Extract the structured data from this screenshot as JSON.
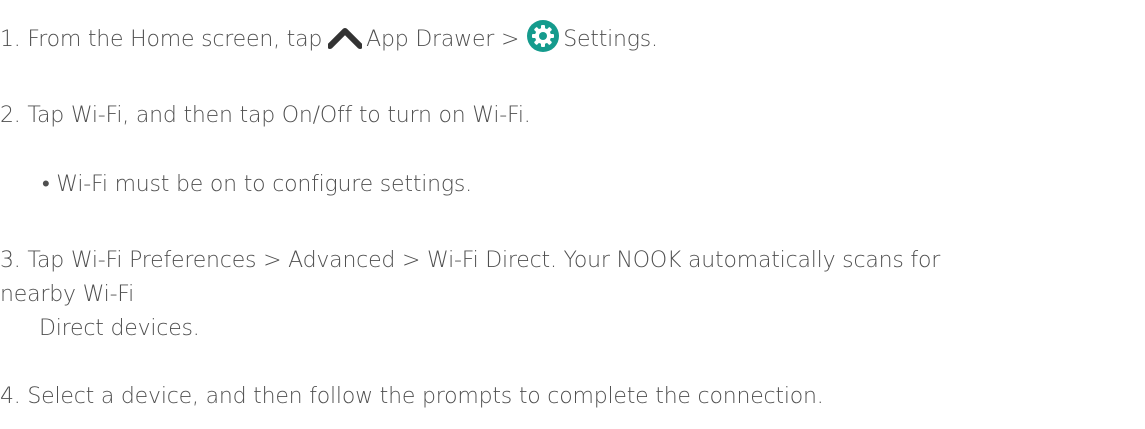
{
  "steps": {
    "step1": {
      "prefix": "1. From the Home screen, tap",
      "app_drawer_label": "App Drawer >",
      "settings_label": "Settings.",
      "settings_icon_color": "#159b8d",
      "chevron_icon_color": "#333333"
    },
    "step2": "2. Tap Wi-Fi, and then tap On/Off to turn on Wi-Fi.",
    "step2_note": "• Wi-Fi must be on to configure settings.",
    "step3": {
      "line1": "3. Tap Wi-Fi Preferences > Advanced > Wi-Fi Direct. Your NOOK automatically scans for",
      "line2": "nearby Wi-Fi",
      "line3": "Direct devices."
    },
    "step4": "4. Select a device, and then follow the prompts to complete the connection."
  },
  "icons": [
    "chevron-up-icon",
    "gear-icon"
  ]
}
